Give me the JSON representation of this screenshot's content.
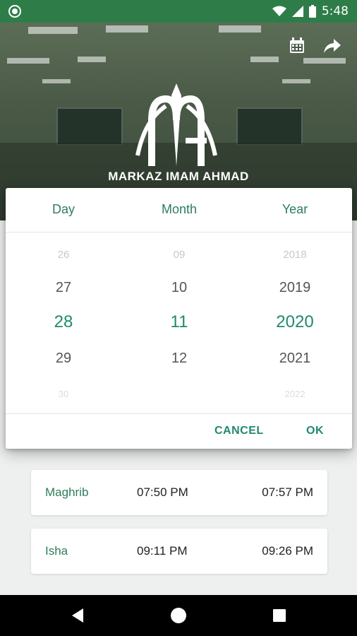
{
  "status_bar": {
    "time": "5:48"
  },
  "header": {
    "logo_text": "MARKAZ IMAM AHMAD"
  },
  "date_picker": {
    "columns": [
      "Day",
      "Month",
      "Year"
    ],
    "day": {
      "items": [
        "26",
        "27",
        "28",
        "29",
        "30"
      ],
      "selected": "28"
    },
    "month": {
      "items": [
        "09",
        "10",
        "11",
        "12"
      ],
      "selected": "11"
    },
    "year": {
      "items": [
        "2018",
        "2019",
        "2020",
        "2021",
        "2022"
      ],
      "selected": "2020"
    },
    "cancel_label": "CANCEL",
    "ok_label": "OK"
  },
  "prayers": [
    {
      "name": "Maghrib",
      "time1": "07:50 PM",
      "time2": "07:57 PM"
    },
    {
      "name": "Isha",
      "time1": "09:11 PM",
      "time2": "09:26 PM"
    }
  ],
  "colors": {
    "status_bar": "#2e7d49",
    "accent": "#1f8a70",
    "text_green": "#2e7d5b"
  }
}
